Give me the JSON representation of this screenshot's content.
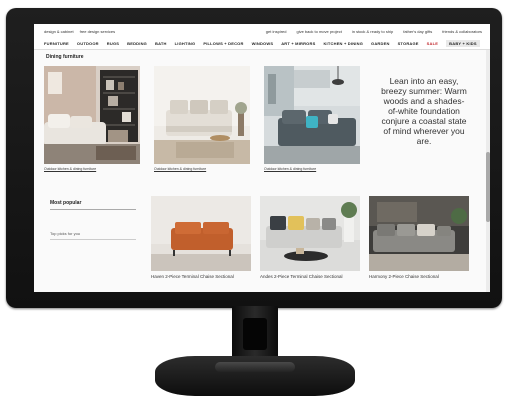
{
  "utility_bar": {
    "left": [
      "design & cabinet",
      "free design services"
    ],
    "right": [
      "get inspired",
      "give back to move project",
      "in stock & ready to ship",
      "father's day gifts",
      "friends & collaborators"
    ]
  },
  "categories": [
    "FURNITURE",
    "OUTDOOR",
    "RUGS",
    "BEDDING",
    "BATH",
    "LIGHTING",
    "PILLOWS + DECOR",
    "WINDOWS",
    "ART + MIRRORS",
    "KITCHEN + DINING",
    "GARDEN",
    "STORAGE",
    "SALE",
    "BABY + KIDS"
  ],
  "section1": {
    "heading": "Dining furniture",
    "cards": [
      {
        "caption": "Outdoor kitchen & dining furniture"
      },
      {
        "caption": "Outdoor kitchen & dining furniture"
      },
      {
        "caption": "Outdoor kitchen & dining furniture"
      }
    ],
    "promo": "Lean into an easy, breezy summer: Warm woods and a shades-of-white foundation conjure a coastal state of mind wherever you are."
  },
  "section2": {
    "heading": "Most popular",
    "subheading": "Top picks for you",
    "products": [
      {
        "name": "Haven 2-Piece Terminal Chaise Sectional"
      },
      {
        "name": "Andes 2-Piece Terminal Chaise Sectional"
      },
      {
        "name": "Harmony 2-Piece Chaise Sectional"
      }
    ]
  },
  "colors": {
    "bezel": "#151515",
    "sale": "#c1272d",
    "page_bg": "#fafafa"
  }
}
